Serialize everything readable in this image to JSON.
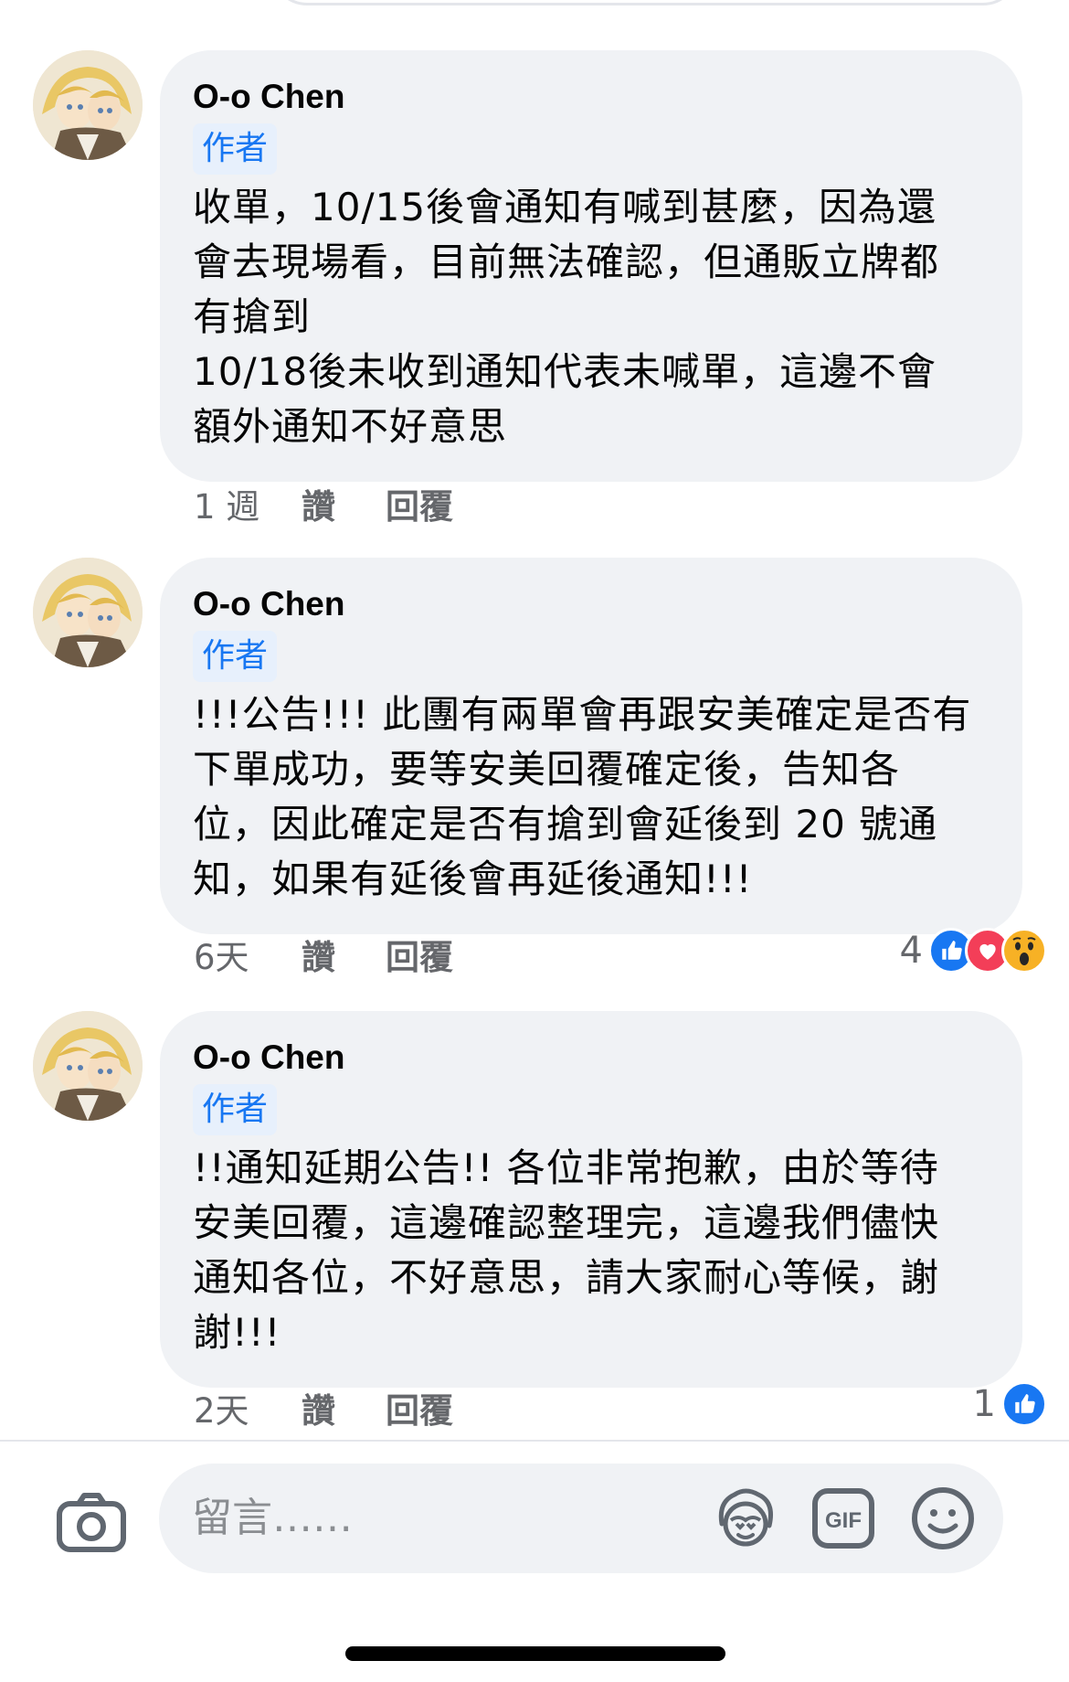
{
  "comments": [
    {
      "author": "O-o Chen",
      "badge": "作者",
      "text": "收單，10/15後會通知有喊到甚麼，因為還\n會去現場看，目前無法確認，但通販立牌都\n有搶到\n10/18後未收到通知代表未喊單，這邊不會\n額外通知不好意思",
      "time": "1 週",
      "like_label": "讚",
      "reply_label": "回覆"
    },
    {
      "author": "O-o Chen",
      "badge": "作者",
      "text": "!!!公告!!! 此團有兩單會再跟安美確定是否有\n下單成功，要等安美回覆確定後，告知各\n位，因此確定是否有搶到會延後到 20 號通\n知，如果有延後會再延後通知!!!",
      "time": "6天",
      "like_label": "讚",
      "reply_label": "回覆",
      "reaction_count": "4",
      "reactions": [
        "like",
        "love",
        "wow"
      ]
    },
    {
      "author": "O-o Chen",
      "badge": "作者",
      "text": "!!通知延期公告!! 各位非常抱歉，由於等待\n安美回覆，這邊確認整理完，這邊我們儘快\n通知各位，不好意思，請大家耐心等候，謝\n謝!!!",
      "time": "2天",
      "like_label": "讚",
      "reply_label": "回覆",
      "reaction_count": "1",
      "reactions": [
        "like"
      ]
    }
  ],
  "composer": {
    "placeholder": "留言……",
    "icons": [
      "camera-icon",
      "avatar-sticker-icon",
      "gif-icon",
      "emoji-icon"
    ]
  },
  "colors": {
    "bubble": "#f0f2f5",
    "badge_text": "#1877f2",
    "badge_bg": "#e7f0fc",
    "meta": "#65676b",
    "like": "#1877f2",
    "love": "#f33e58",
    "wow": "#f7b125"
  }
}
